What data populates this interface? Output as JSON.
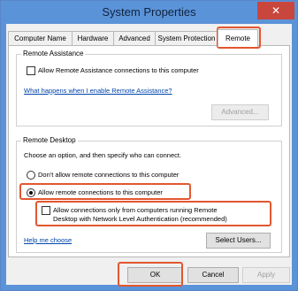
{
  "window": {
    "title": "System Properties",
    "close_glyph": "✕"
  },
  "tabs": [
    {
      "label": "Computer Name",
      "active": false
    },
    {
      "label": "Hardware",
      "active": false
    },
    {
      "label": "Advanced",
      "active": false
    },
    {
      "label": "System Protection",
      "active": false
    },
    {
      "label": "Remote",
      "active": true
    }
  ],
  "remote_assistance": {
    "legend": "Remote Assistance",
    "allow_label": "Allow Remote Assistance connections to this computer",
    "allow_checked": false,
    "help_link": "What happens when I enable Remote Assistance?",
    "advanced_button": "Advanced..."
  },
  "remote_desktop": {
    "legend": "Remote Desktop",
    "instruction": "Choose an option, and then specify who can connect.",
    "option_dont_allow": "Don't allow remote connections to this computer",
    "option_allow": "Allow remote connections to this computer",
    "selected": "allow",
    "nla_label_line1": "Allow connections only from computers running Remote",
    "nla_label_line2": "Desktop with Network Level Authentication (recommended)",
    "nla_checked": false,
    "help_link": "Help me choose",
    "select_users_button": "Select Users..."
  },
  "footer": {
    "ok": "OK",
    "cancel": "Cancel",
    "apply": "Apply"
  },
  "colors": {
    "titlebar": "#5b93d8",
    "close": "#c9463d",
    "highlight": "#e2572f",
    "link": "#0044aa"
  }
}
